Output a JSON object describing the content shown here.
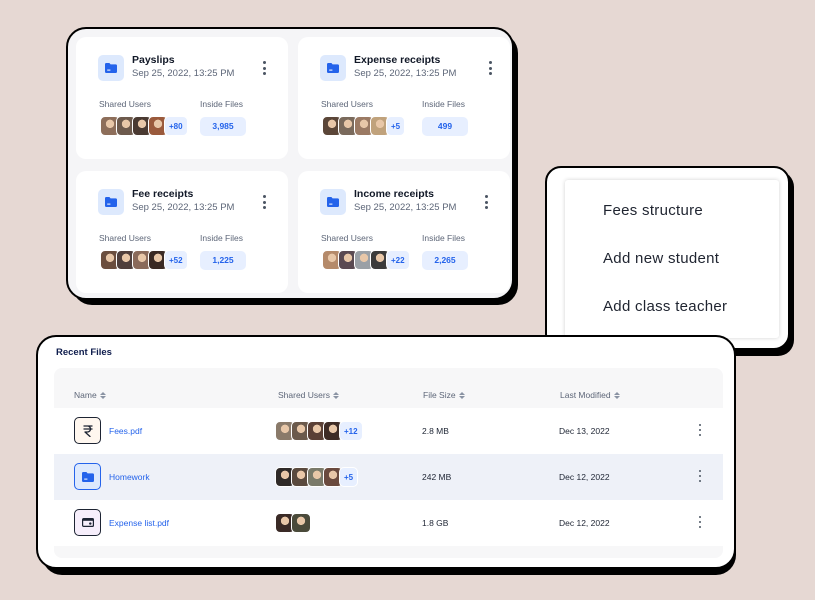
{
  "folders": [
    {
      "title": "Payslips",
      "date": "Sep 25, 2022, 13:25 PM",
      "shared_label": "Shared Users",
      "files_label": "Inside Files",
      "more": "+80",
      "count": "3,985",
      "avatars": [
        "#8d6e5a",
        "#6d5a4d",
        "#4a3a32",
        "#9a5a3c"
      ]
    },
    {
      "title": "Expense receipts",
      "date": "Sep 25, 2022, 13:25 PM",
      "shared_label": "Shared Users",
      "files_label": "Inside Files",
      "more": "+5",
      "count": "499",
      "avatars": [
        "#5b4638",
        "#7a6a5c",
        "#9b7a64",
        "#c0a27c"
      ]
    },
    {
      "title": "Fee receipts",
      "date": "Sep 25, 2022, 13:25 PM",
      "shared_label": "Shared Users",
      "files_label": "Inside Files",
      "more": "+52",
      "count": "1,225",
      "avatars": [
        "#6b4e3e",
        "#4f3f3c",
        "#8a6a5a",
        "#3a2a24"
      ]
    },
    {
      "title": "Income receipts",
      "date": "Sep 25, 2022, 13:25 PM",
      "shared_label": "Shared Users",
      "files_label": "Inside Files",
      "more": "+22",
      "count": "2,265",
      "avatars": [
        "#b58a6a",
        "#5a4a52",
        "#9aa0a6",
        "#3b3b3b"
      ]
    }
  ],
  "menu": {
    "items": [
      "Fees structure",
      "Add new student",
      "Add class teacher"
    ]
  },
  "recent": {
    "title": "Recent Files",
    "columns": [
      "Name",
      "Shared Users",
      "File Size",
      "Last Modified"
    ],
    "rows": [
      {
        "name": "Fees.pdf",
        "icon": "rupee-icon",
        "size": "2.8 MB",
        "modified": "Dec 13, 2022",
        "more": "+12",
        "avatars": [
          "#8a7a6a",
          "#6b5a4c",
          "#5a4036",
          "#3e2c26"
        ]
      },
      {
        "name": "Homework",
        "icon": "folder-icon",
        "size": "242 MB",
        "modified": "Dec 12, 2022",
        "more": "+5",
        "avatars": [
          "#2f2a28",
          "#5a4a3e",
          "#7a7a6a",
          "#6a4a3e"
        ]
      },
      {
        "name": "Expense list.pdf",
        "icon": "wallet-icon",
        "size": "1.8 GB",
        "modified": "Dec 12, 2022",
        "more": "",
        "avatars": [
          "#3a2a26",
          "#4a4a3a"
        ]
      }
    ]
  },
  "colors": {
    "accent": "#2463eb",
    "accent_soft": "#e7efff",
    "background": "#e6d8d3"
  }
}
